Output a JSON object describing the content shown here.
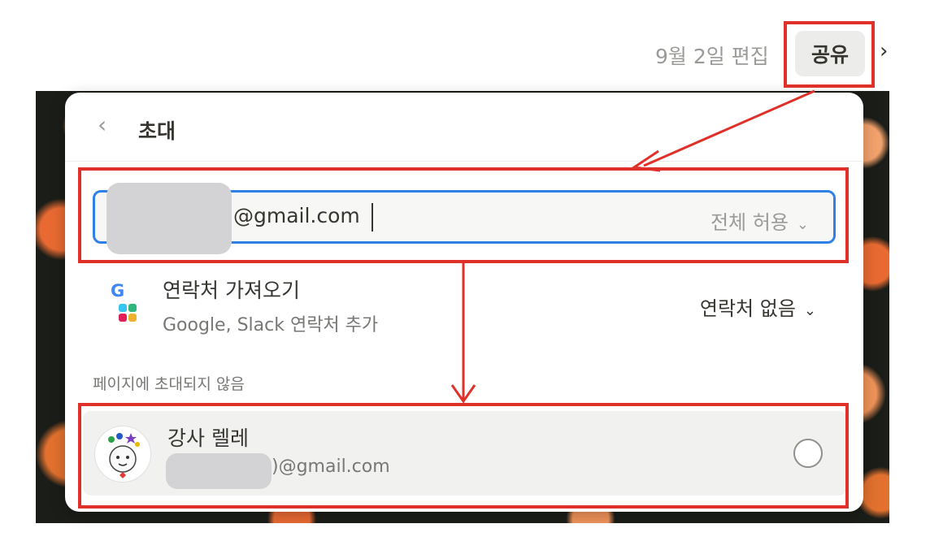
{
  "topbar": {
    "edited_label": "9월 2일 편집",
    "share_label": "공유"
  },
  "invite_panel": {
    "title": "초대",
    "back_icon": "chevron-left-icon",
    "input": {
      "value": "@gmail.com",
      "permission": "전체 허용"
    },
    "import_contacts": {
      "title": "연락처 가져오기",
      "subtitle": "Google, Slack 연락처 추가",
      "select_value": "연락처 없음",
      "icons": [
        "google-icon",
        "slack-icon"
      ]
    },
    "section_label": "페이지에 초대되지 않음",
    "suggestions": [
      {
        "name": "강사 렐레",
        "email": ")@gmail.com",
        "selected": false
      }
    ]
  },
  "colors": {
    "annotation": "#e0302a",
    "focus_border": "#2f80e7",
    "text": "#37352f",
    "muted": "#9b9a97"
  }
}
